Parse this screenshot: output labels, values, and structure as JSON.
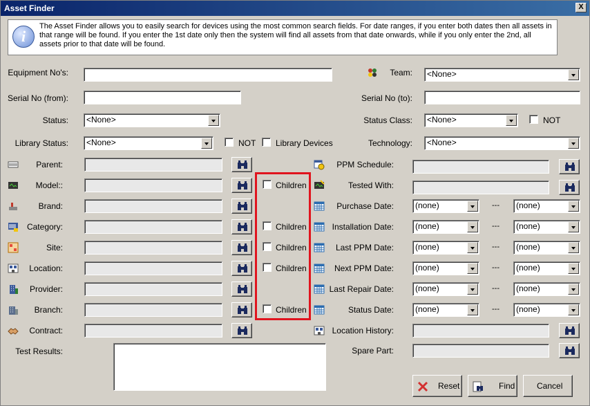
{
  "window": {
    "title": "Asset Finder",
    "close_glyph": "X"
  },
  "info": {
    "icon": "info-icon",
    "glyph": "i",
    "text": "The Asset Finder allows you to easily search for devices using the most common search fields. For date ranges, if you enter both dates then all assets in that range will be found. If you enter the 1st date only then the system will find all assets from that date onwards, while if you only enter the 2nd, all assets prior to that date will be found."
  },
  "labels": {
    "equipment_nos": "Equipment No's:",
    "team": "Team:",
    "serial_from": "Serial No (from):",
    "serial_to": "Serial No (to):",
    "status": "Status:",
    "status_class": "Status Class:",
    "not": "NOT",
    "library_status": "Library Status:",
    "library_devices": "Library Devices",
    "technology": "Technology:",
    "parent": "Parent:",
    "model": "Model::",
    "brand": "Brand:",
    "category": "Category:",
    "site": "Site:",
    "location": "Location:",
    "provider": "Provider:",
    "branch": "Branch:",
    "contract": "Contract:",
    "test_results": "Test Results:",
    "children": "Children",
    "ppm_schedule": "PPM Schedule:",
    "tested_with": "Tested With:",
    "purchase_date": "Purchase Date:",
    "installation_date": "Installation Date:",
    "last_ppm_date": "Last PPM Date:",
    "next_ppm_date": "Next PPM Date:",
    "last_repair_date": "Last Repair Date:",
    "status_date": "Status Date:",
    "location_history": "Location History:",
    "spare_part": "Spare Part:",
    "range_sep": "---"
  },
  "values": {
    "none": "<None>",
    "date_none": "(none)"
  },
  "buttons": {
    "reset": "Reset",
    "find": "Find",
    "cancel": "Cancel"
  },
  "colors": {
    "title_bar": "#0a246a",
    "highlight_box": "#e0141e",
    "dialog_bg": "#d4d0c8"
  }
}
